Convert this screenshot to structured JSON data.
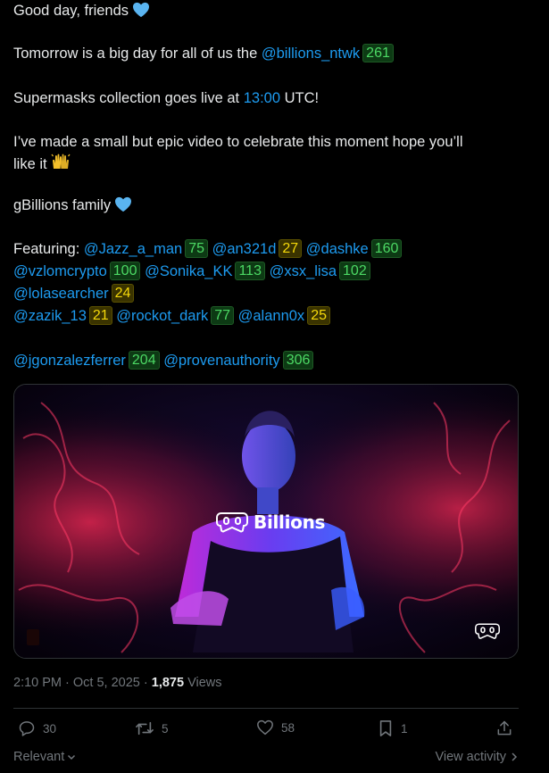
{
  "tweet": {
    "line1": "Good day, friends",
    "line2_prefix": "Tomorrow is a big day for all of us the ",
    "line2_mention": "@billions_ntwk",
    "line2_badge": "261",
    "line3_prefix": "Supermasks collection goes live at ",
    "line3_time": "13:00",
    "line3_suffix": " UTC!",
    "line4": "I’ve made a small but epic video to celebrate this moment hope you’ll",
    "line5": "like it",
    "line6": "gBillions family",
    "featuring_label": "Featuring: ",
    "mentions": [
      {
        "handle": "@Jazz_a_man",
        "count": "75",
        "tier": "green"
      },
      {
        "handle": "@an321d",
        "count": "27",
        "tier": "yellow"
      },
      {
        "handle": "@dashke",
        "count": "160",
        "tier": "green"
      },
      {
        "handle": "@vzlomcrypto",
        "count": "100",
        "tier": "green"
      },
      {
        "handle": "@Sonika_KK",
        "count": "113",
        "tier": "green"
      },
      {
        "handle": "@xsx_lisa",
        "count": "102",
        "tier": "green"
      },
      {
        "handle": "@lolasearcher",
        "count": "24",
        "tier": "yellow"
      },
      {
        "handle": "@zazik_13",
        "count": "21",
        "tier": "yellow"
      },
      {
        "handle": "@rockot_dark",
        "count": "77",
        "tier": "green"
      },
      {
        "handle": "@alann0x",
        "count": "25",
        "tier": "yellow"
      },
      {
        "handle": "@jgonzalezferrer",
        "count": "204",
        "tier": "green"
      },
      {
        "handle": "@provenauthority",
        "count": "306",
        "tier": "green"
      }
    ]
  },
  "media": {
    "brand_text": "Billions"
  },
  "meta": {
    "time": "2:10 PM",
    "separator1": " · ",
    "date": "Oct 5, 2025",
    "separator2": " · ",
    "views_count": "1,875",
    "views_label": " Views"
  },
  "actions": {
    "replies": "30",
    "reposts": "5",
    "likes": "58",
    "bookmarks": "1"
  },
  "footer": {
    "relevant": "Relevant",
    "view_activity": "View activity"
  },
  "colors": {
    "link": "#1d9bf0",
    "badge_green": "#4cd964",
    "badge_yellow": "#f5d90a",
    "heart": "#5ab4f0"
  }
}
